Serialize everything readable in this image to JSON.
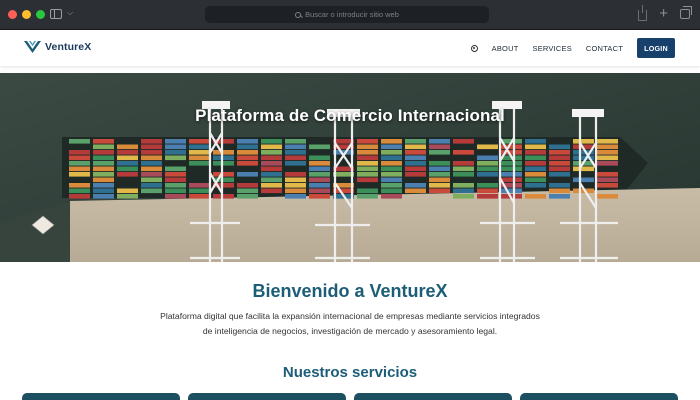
{
  "browser": {
    "address_placeholder": "Buscar o introducir sitio web"
  },
  "nav": {
    "brand": "VentureX",
    "links": [
      "ABOUT",
      "SERVICES",
      "CONTACT"
    ],
    "login": "LOGIN",
    "icons": [
      "globe-icon"
    ]
  },
  "hero": {
    "title": "Plataforma de Comercio Internacional"
  },
  "intro": {
    "title": "Bienvenido a VentureX",
    "description": "Plataforma digital que facilita la expansión internacional de empresas mediante servicios integrados de inteligencia de negocios, investigación de mercado y asesoramiento legal."
  },
  "services": {
    "title": "Nuestros servicios"
  },
  "colors": {
    "brand_dark": "#17406d",
    "heading_teal": "#1c5d78",
    "card_teal": "#1c4f5f"
  }
}
